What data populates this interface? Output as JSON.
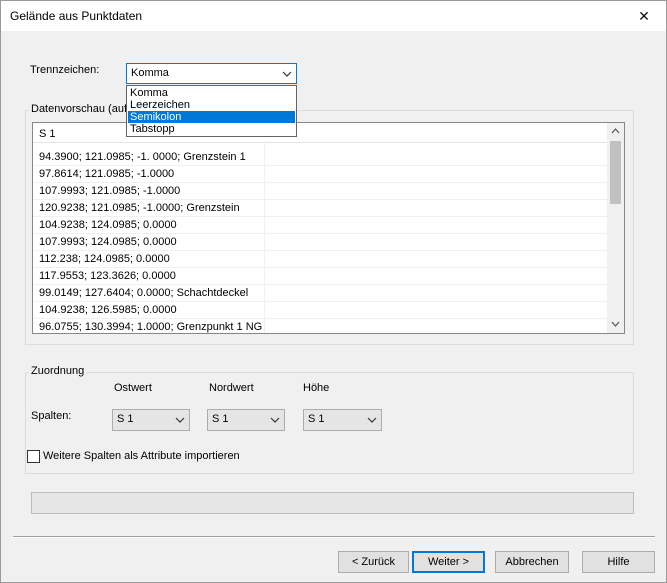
{
  "window": {
    "title": "Gelände aus Punktdaten",
    "close_glyph": "✕"
  },
  "separator": {
    "label": "Trennzeichen:",
    "selected": "Komma",
    "options": [
      "Komma",
      "Leerzeichen",
      "Semikolon",
      "Tabstopp"
    ],
    "highlighted": "Semikolon"
  },
  "preview": {
    "group_label": "Datenvorschau (auf",
    "header": "S 1",
    "rows": [
      "94.3900; 121.0985; -1. 0000; Grenzstein 1",
      "97.8614; 121.0985; -1.0000",
      "107.9993; 121.0985; -1.0000",
      "120.9238; 121.0985; -1.0000; Grenzstein",
      "104.9238; 124.0985; 0.0000",
      "107.9993; 124.0985; 0.0000",
      "112.238; 124.0985; 0.0000",
      "117.9553; 123.3626; 0.0000",
      "99.0149; 127.6404; 0.0000; Schachtdeckel",
      "104.9238; 126.5985; 0.0000",
      "96.0755; 130.3994; 1.0000; Grenzpunkt 1 NG"
    ]
  },
  "mapping": {
    "group_label": "Zuordnung",
    "columns_label": "Spalten:",
    "ostwert": {
      "label": "Ostwert",
      "value": "S 1"
    },
    "nordwert": {
      "label": "Nordwert",
      "value": "S 1"
    },
    "hoehe": {
      "label": "Höhe",
      "value": "S 1"
    },
    "extra_columns_label": "Weitere Spalten als Attribute importieren",
    "extra_columns_checked": false
  },
  "progress": {
    "value": 0
  },
  "buttons": {
    "back": "< Zurück",
    "next": "Weiter >",
    "cancel": "Abbrechen",
    "help": "Hilfe"
  },
  "colors": {
    "accent": "#0078d7",
    "background": "#f0f0f0"
  }
}
